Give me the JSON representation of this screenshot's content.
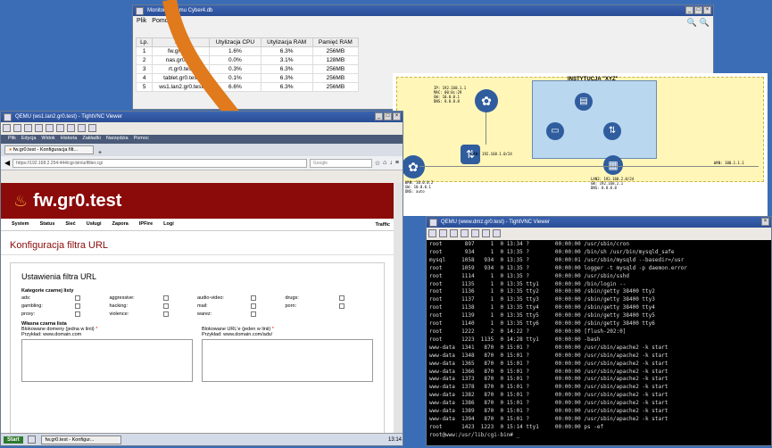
{
  "monitor": {
    "title": "Monitor systemu Cyber4.db",
    "menu": [
      "Plik",
      "Pomoc"
    ],
    "columns": [
      "Lp.",
      "Host",
      "Utylizacja CPU",
      "Utylizacja RAM",
      "Pamięć RAM"
    ],
    "rows": [
      [
        "1",
        "fw.gr0.test",
        "1.6%",
        "6.3%",
        "256MB"
      ],
      [
        "2",
        "nas.gr0.test",
        "0.0%",
        "3.1%",
        "128MB"
      ],
      [
        "3",
        "rt.gr0.test",
        "0.3%",
        "6.3%",
        "256MB"
      ],
      [
        "4",
        "tablet.gr0.test",
        "0.1%",
        "6.3%",
        "256MB"
      ],
      [
        "5",
        "ws1.lan2.gr0.test",
        "6.6%",
        "6.3%",
        "256MB"
      ]
    ]
  },
  "diagram": {
    "title": "INSTYTUCJA \"XYZ\"",
    "left_info": "IP: 192.168.1.1\nMAC: 00:0c:29\nGW: 10.0.0.1\nDNS: 8.8.8.8",
    "mid_label": "LAN: 192.168.1.0/24",
    "left_bottom": "WAN: 10.0.0.2\nGW: 10.0.0.1\nDNS: auto",
    "right_bottom": "LAN2: 192.168.2.0/24\nGW: 192.168.2.1\nDNS: 8.8.8.8",
    "right_edge": "WAN: 100.1.1.1"
  },
  "qemu": {
    "title": "QEMU (ws1.lan2.gr0.test) - TightVNC Viewer",
    "ff_menu": [
      "Plik",
      "Edycja",
      "Widok",
      "Historia",
      "Zakładki",
      "Narzędzia",
      "Pomoc"
    ],
    "tab": "fw.gr0.test - Konfiguracja filt...",
    "url": "https://192.168.2.254:444/cgi-bin/urlfilter.cgi",
    "search_placeholder": "Google",
    "brand": "fw.gr0.test",
    "nav": [
      "System",
      "Status",
      "Sieć",
      "Usługi",
      "Zapora",
      "IPFire",
      "Logi"
    ],
    "nav_right": "Traffic",
    "page_title": "Konfiguracja filtra URL",
    "section": "Ustawienia filtra URL",
    "cat_title": "Kategorie czarnej listy",
    "cats": [
      [
        "ads:",
        "aggressive:",
        "audio-video:",
        "drugs:"
      ],
      [
        "gambling:",
        "hacking:",
        "mail:",
        "porn:"
      ],
      [
        "proxy:",
        "violence:",
        "warez:",
        ""
      ]
    ],
    "own_title": "Własna czarna lista",
    "blocked_domains": "Blokowane domeny (jedna w linii)",
    "blocked_urls": "Blokowane URL'e (jeden w linii)",
    "ex_domains": "Przykład: www.domain.com",
    "ex_urls": "Przykład: www.domain.com/ads/",
    "star": "*",
    "task_start": "Start",
    "task_item": "fw.gr0.test - Konfigur...",
    "clock": "13:14"
  },
  "term": {
    "title": "QEMU (www.dmz.gr0.test) - TightVNC Viewer",
    "lines": [
      "root       897     1  0 13:34 ?        00:00:00 /usr/sbin/cron",
      "root       934     1  0 13:35 ?        00:00:00 /bin/sh /usr/bin/mysqld_safe",
      "mysql     1058   934  0 13:35 ?        00:00:01 /usr/sbin/mysqld --basedir=/usr",
      "root      1059   934  0 13:35 ?        00:00:00 logger -t mysqld -p daemon.error",
      "root      1114     1  0 13:35 ?        00:00:00 /usr/sbin/sshd",
      "root      1135     1  0 13:35 tty1     00:00:00 /bin/login --",
      "root      1136     1  0 13:35 tty2     00:00:00 /sbin/getty 38400 tty2",
      "root      1137     1  0 13:35 tty3     00:00:00 /sbin/getty 38400 tty3",
      "root      1138     1  0 13:35 tty4     00:00:00 /sbin/getty 38400 tty4",
      "root      1139     1  0 13:35 tty5     00:00:00 /sbin/getty 38400 tty5",
      "root      1140     1  0 13:35 tty6     00:00:00 /sbin/getty 38400 tty6",
      "root      1222     2  0 14:22 ?        00:00:00 [flush-202:0]",
      "root      1223  1135  0 14:28 tty1     00:00:00 -bash",
      "www-data  1341   870  0 15:01 ?        00:00:00 /usr/sbin/apache2 -k start",
      "www-data  1348   870  0 15:01 ?        00:00:00 /usr/sbin/apache2 -k start",
      "www-data  1365   870  0 15:01 ?        00:00:00 /usr/sbin/apache2 -k start",
      "www-data  1366   870  0 15:01 ?        00:00:00 /usr/sbin/apache2 -k start",
      "www-data  1373   870  0 15:01 ?        00:00:00 /usr/sbin/apache2 -k start",
      "www-data  1378   870  0 15:01 ?        00:00:00 /usr/sbin/apache2 -k start",
      "www-data  1382   870  0 15:01 ?        00:00:00 /usr/sbin/apache2 -k start",
      "www-data  1386   870  0 15:01 ?        00:00:00 /usr/sbin/apache2 -k start",
      "www-data  1389   870  0 15:01 ?        00:00:00 /usr/sbin/apache2 -k start",
      "www-data  1394   870  0 15:01 ?        00:00:00 /usr/sbin/apache2 -k start",
      "root      1423  1223  0 15:14 tty1     00:00:00 ps -ef",
      "root@www:/usr/lib/cgi-bin# _"
    ]
  },
  "colors": {
    "accent": "#8b0a0a",
    "arrow": "#e07a1c",
    "diagram_bg": "#fff6b8"
  }
}
